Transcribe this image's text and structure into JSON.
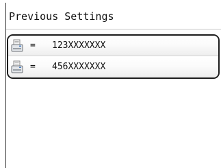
{
  "screen": {
    "title": "Previous Settings"
  },
  "history": {
    "items": [
      {
        "icon": "fax-icon",
        "separator": "=",
        "number": "123XXXXXXX"
      },
      {
        "icon": "fax-icon",
        "separator": "=",
        "number": "456XXXXXXX"
      }
    ]
  }
}
